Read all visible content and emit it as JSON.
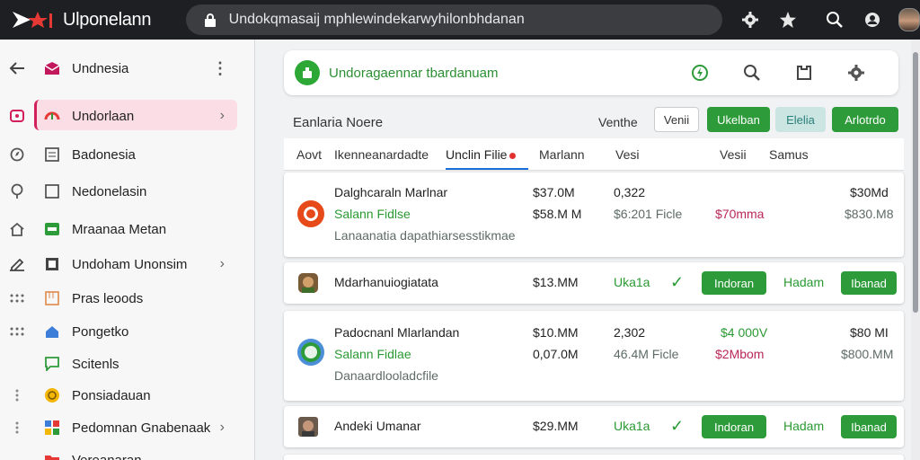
{
  "app": {
    "name": "Ulponelann"
  },
  "address_bar": {
    "url": "Undokqmasaij mphlewindekarwyhilonbhdanan"
  },
  "icons": {
    "top": [
      "settings-icon",
      "star-icon",
      "search-icon",
      "account-icon"
    ],
    "card_top": [
      "bolt-icon",
      "search-icon",
      "bookmark-icon",
      "settings-icon"
    ]
  },
  "colors": {
    "accent_green": "#2e9b3b",
    "active_pink": "#fbdde6",
    "brand_red": "#e53935"
  },
  "sidebar": {
    "header": {
      "label": "Undnesia"
    },
    "items": [
      {
        "label": "Undorlaan",
        "active": true,
        "chevron": "›"
      },
      {
        "label": "Badonesia"
      },
      {
        "label": "Nedonelasin"
      },
      {
        "label": "Mraanaa Metan"
      },
      {
        "label": "Undoham Unonsim",
        "chevron": "›"
      },
      {
        "label": "Pras leoods"
      },
      {
        "label": "Pongetko"
      },
      {
        "label": "Scitenls"
      },
      {
        "label": "Ponsiadauan"
      },
      {
        "label": "Pedomnan Gnabenaak",
        "chevron": "›"
      },
      {
        "label": "Vereanaran"
      }
    ]
  },
  "card_top": {
    "title": "Undoragaennar tbardanuam"
  },
  "filter_row": {
    "label": "Eanlaria Noere",
    "verb": "Venthe",
    "buttons": [
      "Venii",
      "Ukelban",
      "Elelia",
      "Arlotrdo"
    ]
  },
  "tabs": [
    "Aovt",
    "Ikenneanardadte",
    "Unclin Filie",
    "Marlann",
    "Vesi",
    "Vesii",
    "Samus"
  ],
  "rows": [
    {
      "name": "Dalghcaraln Marlnar",
      "sub": "Salann Fidlse",
      "desc": "Lanaanatia dapathiarsesstikmae",
      "amount1": "$37.0M",
      "amount2": "$58.M M",
      "count": "0,322",
      "count2": "$6:201 Ficle",
      "delta": "$70mma",
      "total": "$30Md",
      "total2": "$830.M8"
    },
    {
      "name": "Mdarhanuiogiatata",
      "amount1": "$13.MM",
      "status": "Uka1a",
      "check": "✓",
      "action": "Indoran",
      "status2": "Hadam",
      "action2": "Ibanad"
    },
    {
      "name": "Padocnanl Mlarlandan",
      "sub": "Salann Fidlae",
      "desc": "Danaardlooladcfile",
      "amount1": "$10.MM",
      "amount2": "0,07.0M",
      "count": "2,302",
      "count2": "46.4M Ficle",
      "delta_top": "$4 000V",
      "delta": "$2Mbom",
      "total": "$80 MI",
      "total2": "$800.MM"
    },
    {
      "name": "Andeki Umanar",
      "amount1": "$29.MM",
      "status": "Uka1a",
      "check": "✓",
      "action": "Indoran",
      "status2": "Hadam",
      "action2": "Ibanad"
    }
  ]
}
